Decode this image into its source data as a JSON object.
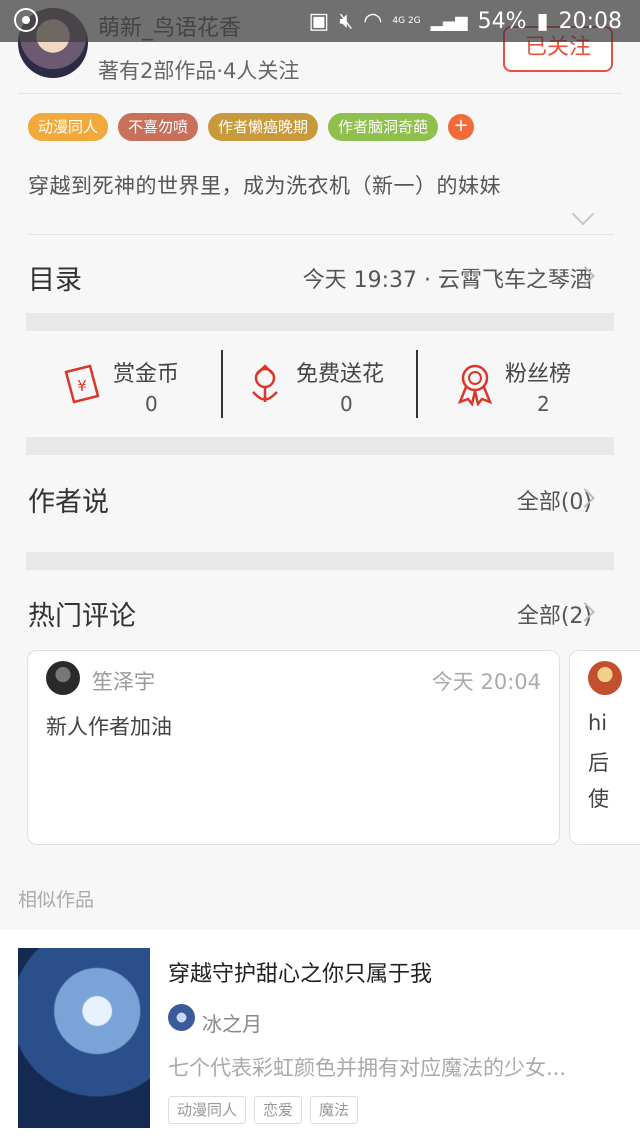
{
  "status_bar": {
    "battery": "54%",
    "time": "20:08",
    "network": "4G 2G"
  },
  "author": {
    "name": "萌新_鸟语花香",
    "meta": "著有2部作品·4人关注",
    "follow_label": "已关注"
  },
  "tags": [
    {
      "label": "动漫同人",
      "color": "#f2a93b"
    },
    {
      "label": "不喜勿喷",
      "color": "#c8705a"
    },
    {
      "label": "作者懒癌晚期",
      "color": "#c99a3c"
    },
    {
      "label": "作者脑洞奇葩",
      "color": "#8fbf4d"
    }
  ],
  "add_tag_label": "+",
  "summary": "穿越到死神的世界里，成为洗衣机（新一）的妹妹",
  "catalog": {
    "title": "目录",
    "latest": "今天 19:37 · 云霄飞车之琴酒"
  },
  "stats": [
    {
      "label": "赏金币",
      "value": "0",
      "icon": "red-envelope-icon"
    },
    {
      "label": "免费送花",
      "value": "0",
      "icon": "flower-icon"
    },
    {
      "label": "粉丝榜",
      "value": "2",
      "icon": "medal-icon"
    }
  ],
  "author_says": {
    "title": "作者说",
    "all": "全部(0)"
  },
  "hot_comments": {
    "title": "热门评论",
    "all": "全部(2)",
    "items": [
      {
        "user": "笙泽宇",
        "time": "今天 20:04",
        "text": "新人作者加油"
      },
      {
        "lines": [
          "hi",
          "后",
          "使"
        ]
      }
    ]
  },
  "similar": {
    "title": "相似作品",
    "book": {
      "title": "穿越守护甜心之你只属于我",
      "author": "冰之月",
      "desc": "七个代表彩虹颜色并拥有对应魔法的少女...",
      "tags": [
        "动漫同人",
        "恋爱",
        "魔法"
      ]
    }
  },
  "colors": {
    "accent": "#e2533c",
    "icon_red": "#d9372a"
  }
}
